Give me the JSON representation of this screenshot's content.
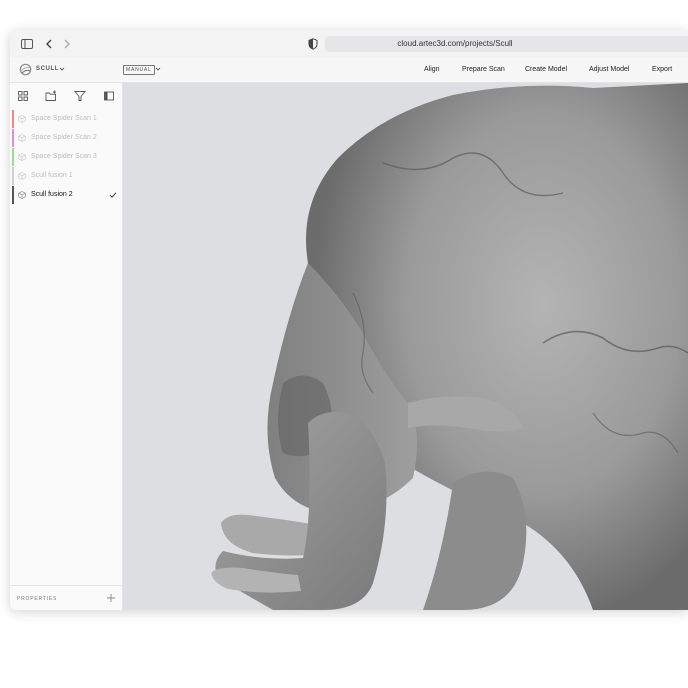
{
  "browser": {
    "url": "cloud.artec3d.com/projects/Scull",
    "icons": [
      "sidebar-toggle-icon",
      "back-arrow-icon",
      "forward-arrow-icon",
      "shield-icon"
    ]
  },
  "header": {
    "project_name": "SCULL",
    "mode": "MANUAL",
    "nav": [
      "Align",
      "Prepare Scan",
      "Create Model",
      "Adjust Model",
      "Export"
    ]
  },
  "sidebar": {
    "tools": [
      "grid-view-icon",
      "folder-add-icon",
      "filter-icon",
      "panel-icon"
    ],
    "items": [
      {
        "label": "Space Spider Scan 1",
        "color": "#f08a8a",
        "active": false
      },
      {
        "label": "Space Spider Scan 2",
        "color": "#e78ad8",
        "active": false
      },
      {
        "label": "Space Spider Scan 3",
        "color": "#93e08e",
        "active": false
      },
      {
        "label": "Scull fusion 1",
        "color": "#cfcfcf",
        "active": false
      },
      {
        "label": "Scull fusion 2",
        "color": "#555555",
        "active": true
      }
    ],
    "properties_label": "PROPERTIES"
  },
  "colors": {
    "viewport_bg": "#dcdee2",
    "model": "#8a8a8a"
  }
}
